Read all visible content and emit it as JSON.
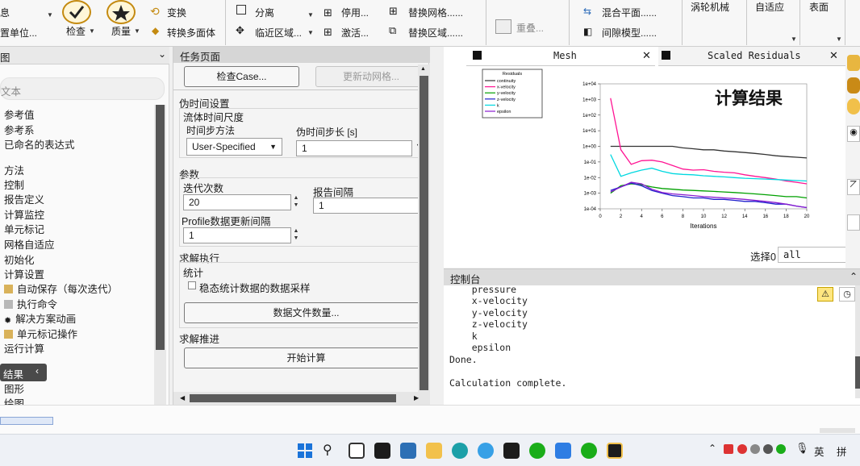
{
  "ribbon": {
    "info_label": "息",
    "units_label": "置单位...",
    "check_label": "检查",
    "quality_label": "质量",
    "transform_label": "变换",
    "convert_poly_label": "转换多面体",
    "separate_label": "分离",
    "adjacent_zone_label": "临近区域...",
    "disable_label": "停用...",
    "activate_label": "激活...",
    "replace_mesh_label": "替换网格......",
    "replace_zone_label": "替换区域......",
    "overlap_label": "重叠...",
    "mixing_plane_label": "混合平面......",
    "gap_model_label": "间隙模型......",
    "turbo_label": "涡轮机械",
    "adapt_label": "自适应",
    "surface_label": "表面"
  },
  "tree": {
    "header": "图",
    "search_placeholder": "文本",
    "items": [
      "参考值",
      "参考系",
      "已命名的表达式",
      "方法",
      "控制",
      "报告定义",
      "计算监控",
      "单元标记",
      "网格自适应",
      "初始化",
      "计算设置",
      "自动保存（每次迭代）",
      "执行命令",
      "解决方案动画",
      "单元标记操作",
      "运行计算",
      "结果",
      "图形",
      "绘图"
    ]
  },
  "task": {
    "header": "任务页面",
    "check_case_label": "检查Case...",
    "update_mesh_label": "更新动网格...",
    "pseudo_time_title": "伪时间设置",
    "fluid_time_scale": "流体时间尺度",
    "time_step_method_label": "时间步方法",
    "time_step_method_value": "User-Specified",
    "pseudo_time_step_label": "伪时间步长 [s]",
    "pseudo_time_step_value": "1",
    "params_title": "参数",
    "iterations_label": "迭代次数",
    "iterations_value": "20",
    "report_interval_label": "报告间隔",
    "report_interval_value": "1",
    "profile_interval_label": "Profile数据更新间隔",
    "profile_interval_value": "1",
    "solve_exec_title": "求解执行",
    "stats_label": "统计",
    "steady_stats_label": "稳态统计数据的数据采样",
    "data_files_label": "数据文件数量...",
    "solve_advance_title": "求解推进",
    "start_calc_label": "开始计算"
  },
  "graphics": {
    "tab_mesh": "Mesh",
    "tab_residuals": "Scaled Residuals",
    "annotation": "计算结果",
    "select_label": "选择0",
    "select_value": "all"
  },
  "chart_data": {
    "type": "line",
    "title": "",
    "xlabel": "Iterations",
    "ylabel": "",
    "y_log_scale": true,
    "xlim": [
      0,
      20
    ],
    "ylim": [
      0.0001,
      10000
    ],
    "x_ticks": [
      "0",
      "2",
      "4",
      "6",
      "8",
      "10",
      "12",
      "14",
      "16",
      "18",
      "20"
    ],
    "y_ticks": [
      "1e-04",
      "1e-03",
      "1e-02",
      "1e-01",
      "1e+00",
      "1e+01",
      "1e+02",
      "1e+03",
      "1e+04"
    ],
    "legend_title": "Residuals",
    "legend_position": "top-left",
    "series": [
      {
        "name": "continuity",
        "color": "#333333",
        "x": [
          1,
          2,
          3,
          4,
          5,
          6,
          7,
          8,
          9,
          10,
          11,
          12,
          13,
          14,
          15,
          16,
          17,
          18,
          19,
          20
        ],
        "y": [
          1,
          1,
          1,
          1,
          1,
          1,
          1,
          0.8,
          0.7,
          0.6,
          0.6,
          0.5,
          0.45,
          0.4,
          0.35,
          0.3,
          0.25,
          0.22,
          0.2,
          0.18
        ]
      },
      {
        "name": "x-velocity",
        "color": "#ff1493",
        "x": [
          1,
          2,
          3,
          4,
          5,
          6,
          7,
          8,
          9,
          10,
          11,
          12,
          13,
          14,
          15,
          16,
          17,
          18,
          19,
          20
        ],
        "y": [
          1200,
          0.6,
          0.07,
          0.12,
          0.13,
          0.1,
          0.06,
          0.035,
          0.03,
          0.032,
          0.025,
          0.022,
          0.02,
          0.015,
          0.012,
          0.01,
          0.008,
          0.006,
          0.005,
          0.004
        ]
      },
      {
        "name": "y-velocity",
        "color": "#00a000",
        "x": [
          1,
          2,
          3,
          4,
          5,
          6,
          7,
          8,
          9,
          10,
          11,
          12,
          13,
          14,
          15,
          16,
          17,
          18,
          19,
          20
        ],
        "y": [
          0.001,
          0.003,
          0.004,
          0.0035,
          0.0025,
          0.002,
          0.0018,
          0.0016,
          0.0015,
          0.0014,
          0.0013,
          0.0012,
          0.0011,
          0.001,
          0.0009,
          0.0008,
          0.0007,
          0.0006,
          0.0006,
          0.0005
        ]
      },
      {
        "name": "z-velocity",
        "color": "#1f1fcc",
        "x": [
          1,
          2,
          3,
          4,
          5,
          6,
          7,
          8,
          9,
          10,
          11,
          12,
          13,
          14,
          15,
          16,
          17,
          18,
          19,
          20
        ],
        "y": [
          0.0015,
          0.0025,
          0.0045,
          0.003,
          0.0015,
          0.001,
          0.0007,
          0.0006,
          0.0005,
          0.0005,
          0.0004,
          0.0004,
          0.00035,
          0.0003,
          0.0003,
          0.00025,
          0.0002,
          0.0002,
          0.00015,
          0.00012
        ]
      },
      {
        "name": "k",
        "color": "#00d8e0",
        "x": [
          1,
          2,
          3,
          4,
          5,
          6,
          7,
          8,
          9,
          10,
          11,
          12,
          13,
          14,
          15,
          16,
          17,
          18,
          19,
          20
        ],
        "y": [
          0.3,
          0.012,
          0.02,
          0.03,
          0.04,
          0.025,
          0.018,
          0.016,
          0.015,
          0.013,
          0.012,
          0.011,
          0.01,
          0.009,
          0.0085,
          0.008,
          0.0075,
          0.007,
          0.0065,
          0.006
        ]
      },
      {
        "name": "epsilon",
        "color": "#8a1bd0",
        "x": [
          1,
          2,
          3,
          4,
          5,
          6,
          7,
          8,
          9,
          10,
          11,
          12,
          13,
          14,
          15,
          16,
          17,
          18,
          19,
          20
        ],
        "y": [
          0.0012,
          0.0025,
          0.005,
          0.004,
          0.0018,
          0.0011,
          0.0009,
          0.0008,
          0.0007,
          0.0006,
          0.00055,
          0.0005,
          0.00045,
          0.0004,
          0.00035,
          0.0003,
          0.00025,
          0.0002,
          0.00015,
          0.00012
        ]
      }
    ]
  },
  "console": {
    "header": "控制台",
    "lines": [
      "    pressure",
      "    x-velocity",
      "    y-velocity",
      "    z-velocity",
      "    k",
      "    epsilon",
      "Done.",
      "",
      "Calculation complete."
    ]
  },
  "taskbar": {
    "ime_label": "英",
    "ime2_label": "拼"
  },
  "colors": {
    "accent_yellow": "#c48a10",
    "panel_header": "#d6d6d6"
  }
}
